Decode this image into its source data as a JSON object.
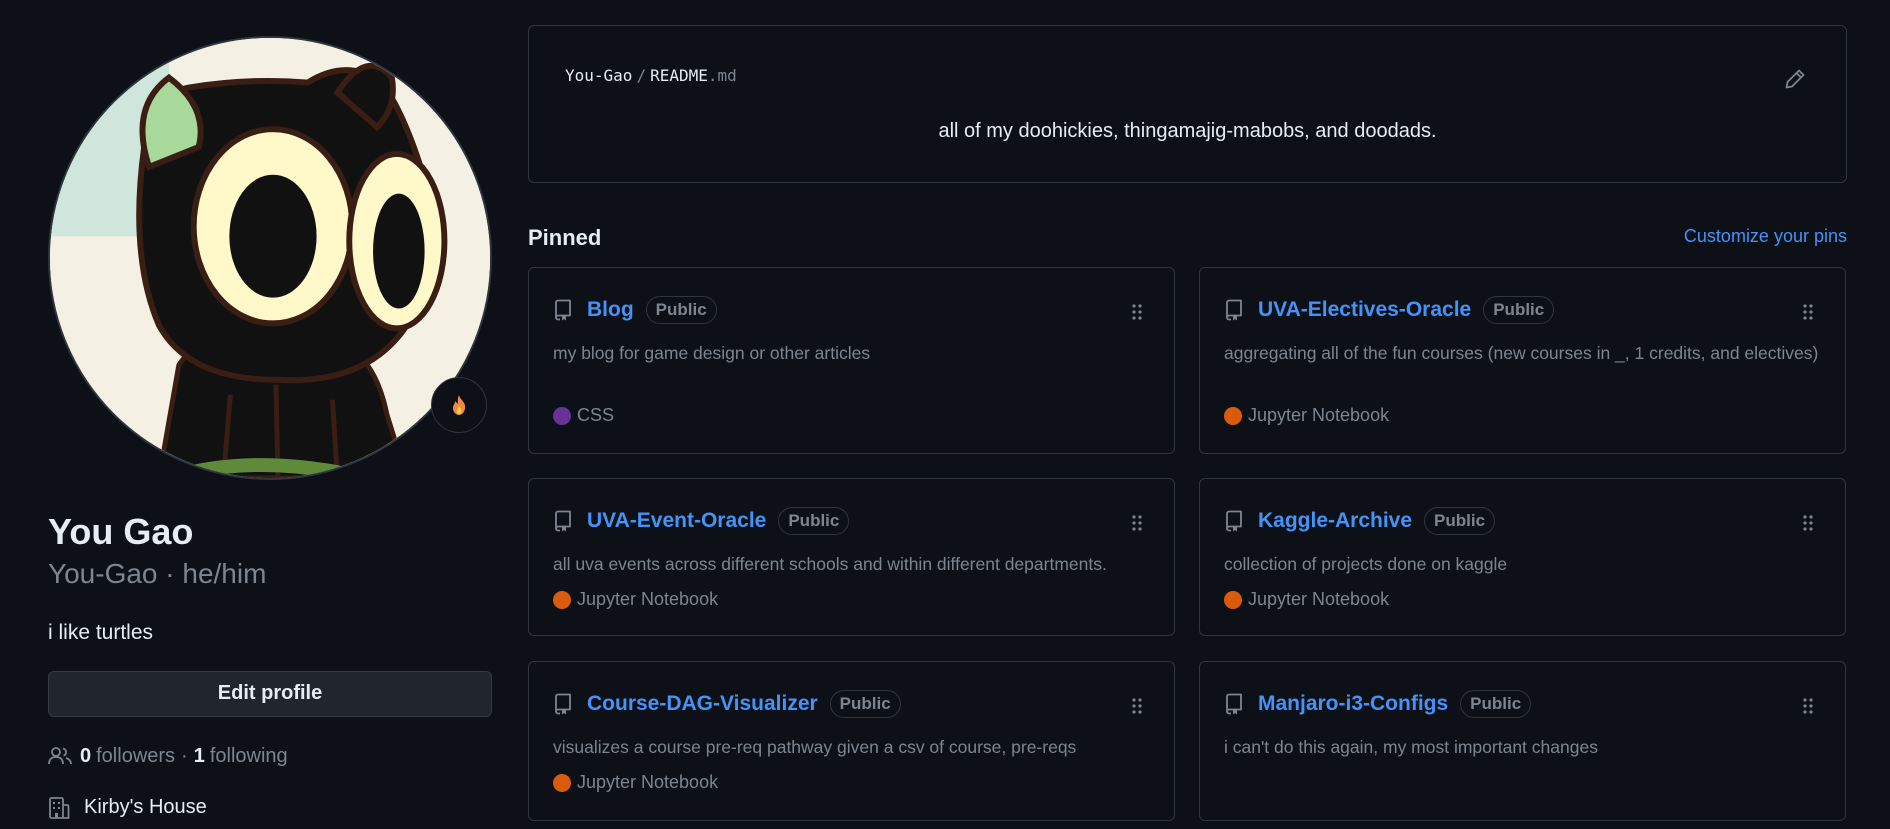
{
  "profile": {
    "name": "You Gao",
    "login_line": "You-Gao · he/him",
    "bio": "i like turtles",
    "edit_label": "Edit profile",
    "followers_count": "0",
    "followers_label": "followers",
    "separator": "·",
    "following_count": "1",
    "following_label": "following",
    "organization": "Kirby's House",
    "status_icon": "flame-icon"
  },
  "readme": {
    "owner": "You-Gao",
    "slash": "/",
    "file_base": "README",
    "file_ext": ".md",
    "text": "all of my doohickies, thingamajig-mabobs, and doodads."
  },
  "pinned": {
    "title": "Pinned",
    "customize_label": "Customize your pins",
    "repos": [
      {
        "name": "Blog",
        "visibility": "Public",
        "description": "my blog for game design or other articles",
        "language": "CSS",
        "lang_color": "#663399"
      },
      {
        "name": "UVA-Electives-Oracle",
        "visibility": "Public",
        "description": "aggregating all of the fun courses (new courses in _, 1 credits, and electives)",
        "language": "Jupyter Notebook",
        "lang_color": "#DA5B0B"
      },
      {
        "name": "UVA-Event-Oracle",
        "visibility": "Public",
        "description": "all uva events across different schools and within different departments.",
        "language": "Jupyter Notebook",
        "lang_color": "#DA5B0B"
      },
      {
        "name": "Kaggle-Archive",
        "visibility": "Public",
        "description": "collection of projects done on kaggle",
        "language": "Jupyter Notebook",
        "lang_color": "#DA5B0B"
      },
      {
        "name": "Course-DAG-Visualizer",
        "visibility": "Public",
        "description": "visualizes a course pre-req pathway given a csv of course, pre-reqs",
        "language": "Jupyter Notebook",
        "lang_color": "#DA5B0B"
      },
      {
        "name": "Manjaro-i3-Configs",
        "visibility": "Public",
        "description": "i can't do this again, my most important changes",
        "language": "",
        "lang_color": ""
      }
    ]
  },
  "colors": {
    "background": "#0d1117",
    "border": "#30363d",
    "link": "#4493f8",
    "muted": "#7d8590",
    "text": "#e6edf3"
  }
}
